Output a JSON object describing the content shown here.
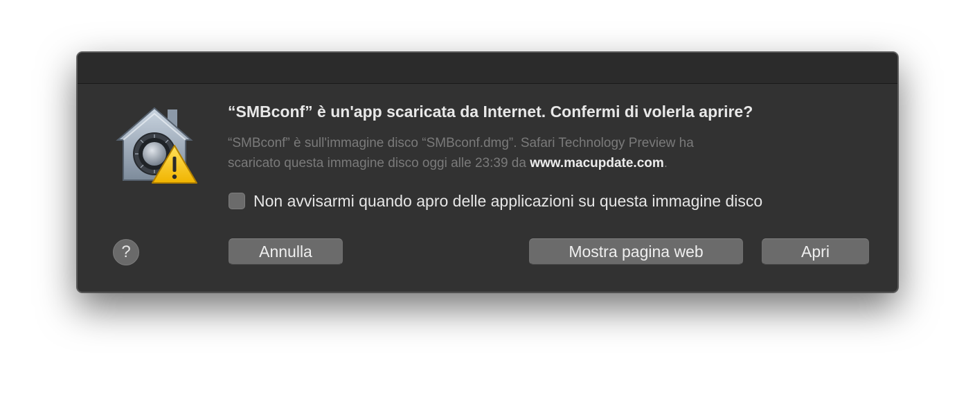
{
  "dialog": {
    "headline": "“SMBconf” è un'app scaricata da Internet. Confermi di volerla aprire?",
    "info_line1": "“SMBconf” è sull'immagine disco “SMBconf.dmg”. Safari Technology Preview ha",
    "info_line2_prefix": "scaricato questa immagine disco oggi alle 23:39 da ",
    "info_host": "www.macupdate.com",
    "info_line2_suffix": ".",
    "checkbox_label": "Non avvisarmi quando apro delle applicazioni su questa immagine disco",
    "checkbox_checked": false,
    "help_label": "?",
    "buttons": {
      "cancel": "Annulla",
      "show_web_page": "Mostra pagina web",
      "open": "Apri"
    },
    "icon": "gatekeeper-warning-icon"
  },
  "colors": {
    "dialog_background": "#323232",
    "warning_yellow": "#f5c518"
  }
}
